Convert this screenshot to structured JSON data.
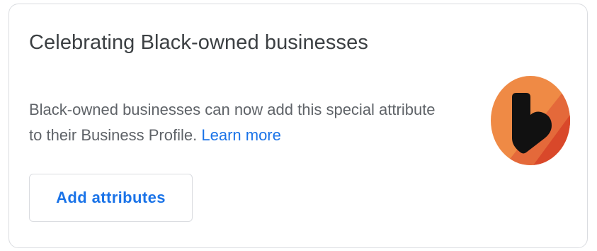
{
  "card": {
    "title": "Celebrating Black-owned businesses",
    "description": "Black-owned businesses can now add this special attribute to their Business Profile.",
    "learn_more_label": "Learn more",
    "button_label": "Add attributes",
    "icon": "black-owned-heart-badge-icon"
  },
  "colors": {
    "text_primary": "#3c4043",
    "text_secondary": "#5f6368",
    "accent": "#1a73e8",
    "border": "#dadce0",
    "badge_orange_light": "#ef8a45",
    "badge_orange_dark": "#d9482a",
    "badge_heart": "#111111"
  }
}
